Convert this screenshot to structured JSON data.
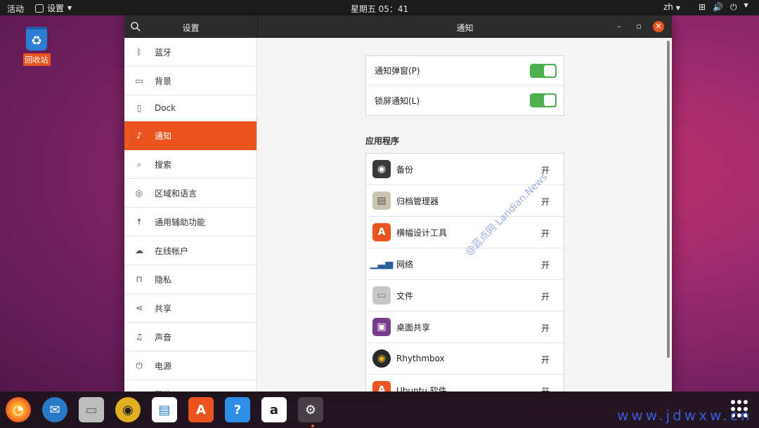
{
  "topbar": {
    "activities": "活动",
    "app_menu": "设置",
    "clock": "星期五 05：41",
    "lang": "zh"
  },
  "desktop": {
    "trash_label": "回收站"
  },
  "window": {
    "sidebar_title": "设置",
    "main_title": "通知"
  },
  "sidebar": {
    "items": [
      {
        "label": "蓝牙",
        "icon": "bluetooth-icon"
      },
      {
        "label": "背景",
        "icon": "background-icon"
      },
      {
        "label": "Dock",
        "icon": "dock-icon"
      },
      {
        "label": "通知",
        "icon": "bell-icon"
      },
      {
        "label": "搜索",
        "icon": "search-icon"
      },
      {
        "label": "区域和语言",
        "icon": "globe-icon"
      },
      {
        "label": "通用辅助功能",
        "icon": "accessibility-icon"
      },
      {
        "label": "在线帐户",
        "icon": "cloud-icon"
      },
      {
        "label": "隐私",
        "icon": "lock-icon"
      },
      {
        "label": "共享",
        "icon": "share-icon"
      },
      {
        "label": "声音",
        "icon": "music-note-icon"
      },
      {
        "label": "电源",
        "icon": "power-icon"
      },
      {
        "label": "网络",
        "icon": "network-icon"
      }
    ]
  },
  "notifications": {
    "popups_label": "通知弹窗(P)",
    "lockscreen_label": "锁屏通知(L)",
    "popups_on": true,
    "lockscreen_on": true
  },
  "apps": {
    "section_title": "应用程序",
    "rows": [
      {
        "name": "备份",
        "state": "开"
      },
      {
        "name": "归档管理器",
        "state": "开"
      },
      {
        "name": "横幅设计工具",
        "state": "开"
      },
      {
        "name": "网络",
        "state": "开"
      },
      {
        "name": "文件",
        "state": "开"
      },
      {
        "name": "桌面共享",
        "state": "开"
      },
      {
        "name": "Rhythmbox",
        "state": "开"
      },
      {
        "name": "Ubuntu 软件",
        "state": "开"
      }
    ]
  },
  "watermark": "@蓝点网 Landian.News",
  "site_mark": "www.jdwxw.cn",
  "colors": {
    "accent": "#e95420",
    "switch_on": "#4caf50",
    "topbar": "#1d1d1d"
  }
}
